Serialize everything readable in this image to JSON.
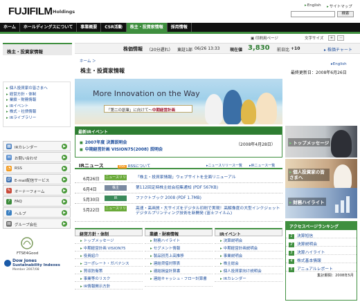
{
  "header": {
    "brand": "FUJIFILM",
    "brand_sub": "Holdings",
    "links": [
      "English",
      "サイトマップ"
    ],
    "search_button": "検索"
  },
  "nav": {
    "items": [
      "ホーム",
      "ホールディングスについて",
      "事業概要",
      "CSR活動",
      "株主・投資家情報",
      "採用情報"
    ],
    "active_index": 4
  },
  "utility": {
    "print": "印刷用ページ",
    "font_size": "文字サイズ",
    "font_plus": "+",
    "font_minus": "－"
  },
  "stock": {
    "label": "株価情報",
    "delay_note": "（20分遅れ）",
    "market": "東証1部",
    "datetime": "06/26 13:33",
    "current_label": "現在値",
    "price": "3,830",
    "change_label": "前日比",
    "change": "+10",
    "chart_link": "株価チャート"
  },
  "sidebar": {
    "title": "株主・投資家情報",
    "items": [
      "個人投資家の皆さまへ",
      "経営方針・体制",
      "業績・財務情報",
      "IRイベント",
      "株式・社債情報",
      "IRライブラリー"
    ],
    "boxes": [
      {
        "label": "IRカレンダー",
        "icon": "calendar-icon",
        "color": "#4a7fbf"
      },
      {
        "label": "お問い合わせ",
        "icon": "mail-icon",
        "color": "#5a8fcf"
      },
      {
        "label": "RSS",
        "icon": "rss-icon",
        "color": "#f39a1e"
      },
      {
        "label": "E-mail配信サービス",
        "icon": "email-icon",
        "color": "#3a6fb0"
      },
      {
        "label": "オーナーフォーム",
        "icon": "form-icon",
        "color": "#c94a3a"
      },
      {
        "label": "FAQ",
        "icon": "faq-icon",
        "color": "#3a8a3a"
      },
      {
        "label": "ヘルプ",
        "icon": "help-icon",
        "color": "#3a7fc0"
      },
      {
        "label": "グループ会社",
        "icon": "group-icon",
        "color": "#666666"
      }
    ],
    "ftse": "FTSE4Good",
    "dj_line1": "Dow Jones",
    "dj_line2": "Sustainability Indexes",
    "dj_line3": "Member 2007/08"
  },
  "main": {
    "breadcrumb": "ホーム ＞",
    "page_title": "株主・投資家情報",
    "english_link": "English",
    "last_updated": "最終更新日：2008年6月26日",
    "banner_title": "More Innovation on the Way",
    "banner_sub_a": "「第二の創業」に向けて〜",
    "banner_sub_b": "中期経営計画"
  },
  "ir_event": {
    "heading": "最新IRイベント",
    "items": [
      "2007年度 決算説明会",
      "中期経営計画 VISION75(2008) 説明会"
    ],
    "date": "（2008年4月28日）"
  },
  "news": {
    "heading": "IRニュース",
    "rss_badge": "RSS",
    "rss_label": "RSSについて",
    "link_a": "ニュースリリース一覧",
    "link_b": "IRニュース一覧",
    "rows": [
      {
        "date": "6月26日",
        "tag": "ニュースリリース",
        "tag_color": "#6aaa3a",
        "text": "「株主・投資家情報」ウェブサイトを全面リニューアル"
      },
      {
        "date": "6月4日",
        "tag": "株主",
        "tag_color": "#7a8aa0",
        "text": "第112回定時株主総会招集通知 (PDF 567KB)"
      },
      {
        "date": "5月30日",
        "tag": "IR",
        "tag_color": "#3a8a5a",
        "text": "ファクトブック 2008 (PDF 1.7MB)"
      },
      {
        "date": "5月22日",
        "tag": "ニュースリリース",
        "tag_color": "#6aaa3a",
        "text": "高速・高画質・大サイズをデジタル印刷で実現！高解像度の大型インクジェットデジタルプリンティング技術を新開発 (富士フイルム)"
      }
    ]
  },
  "sections": [
    {
      "heading": "経営方針・体制",
      "items": [
        "トップメッセージ",
        "中期経営計画 VISION75",
        "役員紹介",
        "コーポレート・ガバナンス",
        "買収防衛策",
        "事業等のリスク",
        "IR情報開示方針"
      ]
    },
    {
      "heading": "業績・財務情報",
      "items": [
        "財務ハイライト",
        "セグメント情報",
        "製品別売上高推移",
        "連結貸借対照表",
        "連結損益計算書",
        "連結キャッシュ・フロー計算書"
      ]
    },
    {
      "heading": "IRイベント",
      "items": [
        "決算説明会",
        "中期経営計画説明会",
        "事業説明会",
        "株主総会",
        "個人投資家向け説明会",
        "IRカレンダー"
      ]
    }
  ],
  "right_boxes": [
    "トップメッセージ",
    "個人投資家の皆さまへ",
    "財務ハイライト"
  ],
  "ranking": {
    "heading": "アクセスページランキング",
    "items": [
      "決算短信",
      "決算説明会",
      "決算ハイライト",
      "株式基本情報",
      "アニュアルレポート"
    ],
    "totals": "集計期間：2008年5月"
  }
}
